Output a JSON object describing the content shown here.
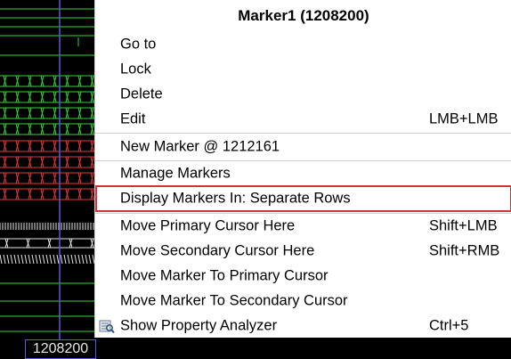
{
  "menu": {
    "title": "Marker1 (1208200)",
    "items": [
      {
        "label": "Go to",
        "shortcut": ""
      },
      {
        "label": "Lock",
        "shortcut": ""
      },
      {
        "label": "Delete",
        "shortcut": ""
      },
      {
        "label": "Edit",
        "shortcut": "LMB+LMB"
      },
      {
        "label": "New Marker @ 1212161",
        "shortcut": ""
      },
      {
        "label": "Manage Markers",
        "shortcut": ""
      },
      {
        "label": "Display Markers In: Separate Rows",
        "shortcut": ""
      },
      {
        "label": "Move Primary Cursor Here",
        "shortcut": "Shift+LMB"
      },
      {
        "label": "Move Secondary Cursor Here",
        "shortcut": "Shift+RMB"
      },
      {
        "label": "Move Marker To Primary Cursor",
        "shortcut": ""
      },
      {
        "label": "Move Marker To Secondary Cursor",
        "shortcut": ""
      },
      {
        "label": "Show Property Analyzer",
        "shortcut": "Ctrl+5",
        "icon": "property-analyzer-icon"
      }
    ]
  },
  "waveform": {
    "marker_time_label": "1208200",
    "colors": {
      "signal_green": "#3ecf3e",
      "signal_red": "#e03a3a",
      "marker_blue": "#5b5bd6",
      "highlight_red": "#d0343a"
    }
  }
}
